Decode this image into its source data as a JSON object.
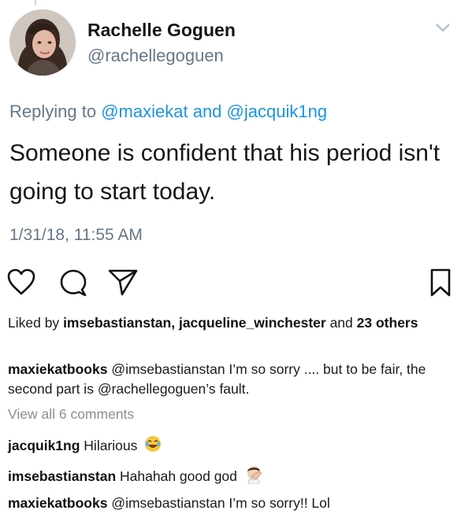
{
  "tweet": {
    "name": "Rachelle Goguen",
    "handle": "@rachellegoguen",
    "replying_prefix": "Replying to",
    "replying_to_1": "@maxiekat",
    "replying_and": "and",
    "replying_to_2": "@jacquik1ng",
    "text": "Someone is confident that his period isn't going to start today.",
    "timestamp": "1/31/18, 11:55 AM",
    "icons": {
      "menu": "chevron-down-icon"
    },
    "colors": {
      "handle": "#657786",
      "mention": "#1b95e0"
    }
  },
  "instagram": {
    "icons": [
      "heart-icon",
      "comment-icon",
      "share-icon",
      "bookmark-icon"
    ],
    "liked": {
      "prefix": "Liked by",
      "user1": "imsebastianstan",
      "sep": ",",
      "user2": "jacqueline_winchester",
      "and": "and",
      "others": "23 others"
    },
    "caption": {
      "user": "maxiekatbooks",
      "mention": "@imsebastianstan",
      "text1": " I’m so sorry .... but to be fair, the second part is ",
      "mention2": "@rachellegoguen",
      "text2": "’s fault."
    },
    "view_all": "View all 6 comments",
    "comments": [
      {
        "user": "jacquik1ng",
        "text": "Hilarious",
        "emoji": "laughing-tears-emoji"
      },
      {
        "user": "imsebastianstan",
        "text": "Hahahah good god",
        "emoji": "facepalm-emoji"
      },
      {
        "user": "maxiekatbooks",
        "text": "@imsebastianstan I’m so sorry!! Lol"
      }
    ]
  }
}
